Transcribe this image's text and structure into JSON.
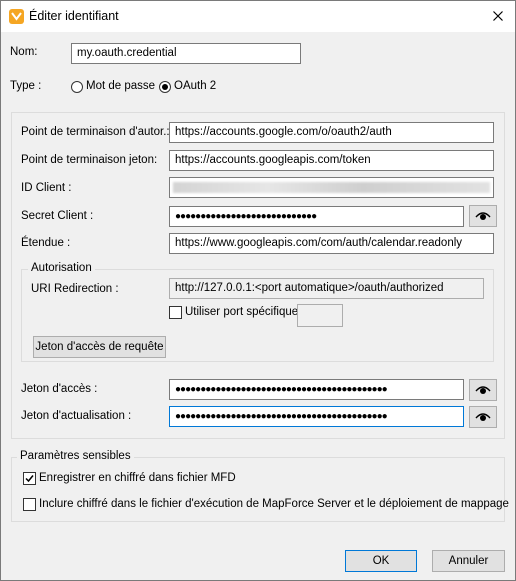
{
  "window": {
    "title": "Éditer identifiant"
  },
  "form": {
    "name_label": "Nom:",
    "name_value": "my.oauth.credential",
    "type_label": "Type :",
    "type_options": [
      "Mot de passe",
      "OAuth 2"
    ],
    "type_selected": "OAuth 2"
  },
  "oauth": {
    "auth_endpoint_label": "Point de terminaison d'autor.:",
    "auth_endpoint_value": "https://accounts.google.com/o/oauth2/auth",
    "token_endpoint_label": "Point de terminaison jeton:",
    "token_endpoint_value": "https://accounts.googleapis.com/token",
    "client_id_label": "ID Client :",
    "client_secret_label": "Secret Client :",
    "client_secret_value": "●●●●●●●●●●●●●●●●●●●●●●●●●●●●",
    "scope_label": "Étendue :",
    "scope_value": "https://www.googleapis.com/com/auth/calendar.readonly"
  },
  "authorization": {
    "group_title": "Autorisation",
    "redirect_label": "URI Redirection :",
    "redirect_value": "http://127.0.0.1:<port automatique>/oauth/authorized",
    "specific_port_label": "Utiliser port spécifique",
    "specific_port_checked": false,
    "request_token_button": "Jeton d'accès de requête"
  },
  "tokens": {
    "access_label": "Jeton d'accès :",
    "access_value": "●●●●●●●●●●●●●●●●●●●●●●●●●●●●●●●●●●●●●●●●●●",
    "refresh_label": "Jeton d'actualisation :",
    "refresh_value": "●●●●●●●●●●●●●●●●●●●●●●●●●●●●●●●●●●●●●●●●●●"
  },
  "sensitive": {
    "group_title": "Paramètres sensibles",
    "save_encrypted_label": "Enregistrer en chiffré dans fichier MFD",
    "save_encrypted_checked": true,
    "include_encrypted_label": "Inclure chiffré dans le fichier d'exécution de MapForce Server et le déploiement de mappage",
    "include_encrypted_checked": false
  },
  "footer": {
    "ok_label": "OK",
    "cancel_label": "Annuler"
  },
  "icons": {
    "eye": "eye-icon",
    "close": "close-icon",
    "app": "app-icon"
  },
  "colors": {
    "focus_border": "#0078d7",
    "window_bg": "#f0f0f0",
    "app_icon": "#f5a623"
  }
}
